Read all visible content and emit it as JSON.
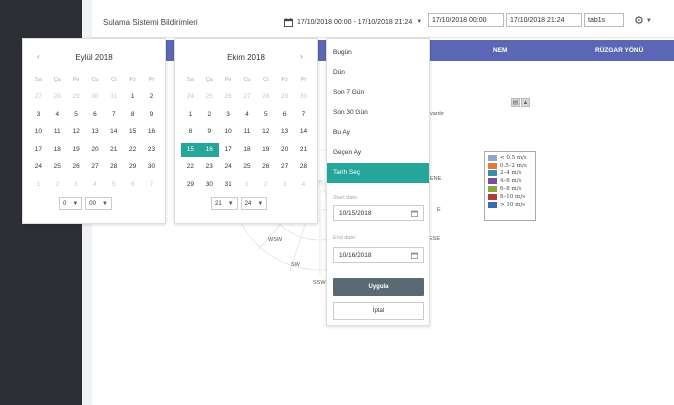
{
  "header": {
    "title": "Sulama Sistemi Bildirimleri",
    "range_label": "17/10/2018 00:00 - 17/10/2018 21:24",
    "input_start": "17/10/2018 00:00",
    "input_end": "17/10/2018 21:24",
    "input_tab": "tab1s"
  },
  "table": {
    "col_nem": "NEM",
    "col_ruzgar": "RÜZGAR YÖNÜ"
  },
  "chart": {
    "note": "vardır",
    "compass": {
      "ene": "ENE",
      "e": "E",
      "ese": "ESE",
      "wsw": "WSW",
      "sw": "SW",
      "ssw": "SSW"
    },
    "legend": [
      {
        "label": "< 0.5 m/s",
        "color": "#8fa8c8"
      },
      {
        "label": "0.5–2 m/s",
        "color": "#e07b39"
      },
      {
        "label": "2–4 m/s",
        "color": "#3a8fa6"
      },
      {
        "label": "4–6 m/s",
        "color": "#7b4ea3"
      },
      {
        "label": "6–8 m/s",
        "color": "#8aa83a"
      },
      {
        "label": "8–10 m/s",
        "color": "#b23a3a"
      },
      {
        "label": "> 10 m/s",
        "color": "#3a6ab2"
      }
    ]
  },
  "calendar1": {
    "title": "Eylül 2018",
    "days_of_week": [
      "Sa",
      "Ça",
      "Pe",
      "Cu",
      "Ct",
      "Pz",
      "Pt"
    ],
    "weeks": [
      [
        {
          "d": "27",
          "o": true
        },
        {
          "d": "28",
          "o": true
        },
        {
          "d": "29",
          "o": true
        },
        {
          "d": "30",
          "o": true
        },
        {
          "d": "31",
          "o": true
        },
        {
          "d": "1"
        },
        {
          "d": "2"
        }
      ],
      [
        {
          "d": "3"
        },
        {
          "d": "4"
        },
        {
          "d": "5"
        },
        {
          "d": "6"
        },
        {
          "d": "7"
        },
        {
          "d": "8"
        },
        {
          "d": "9"
        }
      ],
      [
        {
          "d": "10"
        },
        {
          "d": "11"
        },
        {
          "d": "12"
        },
        {
          "d": "13"
        },
        {
          "d": "14"
        },
        {
          "d": "15"
        },
        {
          "d": "16"
        }
      ],
      [
        {
          "d": "17"
        },
        {
          "d": "18"
        },
        {
          "d": "19"
        },
        {
          "d": "20"
        },
        {
          "d": "21"
        },
        {
          "d": "22"
        },
        {
          "d": "23"
        }
      ],
      [
        {
          "d": "24"
        },
        {
          "d": "25"
        },
        {
          "d": "26"
        },
        {
          "d": "27"
        },
        {
          "d": "28"
        },
        {
          "d": "29"
        },
        {
          "d": "30"
        }
      ],
      [
        {
          "d": "1",
          "o": true
        },
        {
          "d": "2",
          "o": true
        },
        {
          "d": "3",
          "o": true
        },
        {
          "d": "4",
          "o": true
        },
        {
          "d": "5",
          "o": true
        },
        {
          "d": "6",
          "o": true
        },
        {
          "d": "7",
          "o": true
        }
      ]
    ],
    "hour": "0",
    "minute": "00"
  },
  "calendar2": {
    "title": "Ekim 2018",
    "days_of_week": [
      "Sa",
      "Ça",
      "Pe",
      "Cu",
      "Ct",
      "Pz",
      "Pt"
    ],
    "weeks": [
      [
        {
          "d": "24",
          "o": true
        },
        {
          "d": "25",
          "o": true
        },
        {
          "d": "26",
          "o": true
        },
        {
          "d": "27",
          "o": true
        },
        {
          "d": "28",
          "o": true
        },
        {
          "d": "29",
          "o": true
        },
        {
          "d": "30",
          "o": true
        }
      ],
      [
        {
          "d": "1"
        },
        {
          "d": "2"
        },
        {
          "d": "3"
        },
        {
          "d": "4"
        },
        {
          "d": "5"
        },
        {
          "d": "6"
        },
        {
          "d": "7"
        }
      ],
      [
        {
          "d": "8"
        },
        {
          "d": "9"
        },
        {
          "d": "10"
        },
        {
          "d": "11"
        },
        {
          "d": "12"
        },
        {
          "d": "13"
        },
        {
          "d": "14"
        }
      ],
      [
        {
          "d": "15",
          "s": true
        },
        {
          "d": "16",
          "s": true
        },
        {
          "d": "17"
        },
        {
          "d": "18"
        },
        {
          "d": "19"
        },
        {
          "d": "20"
        },
        {
          "d": "21"
        }
      ],
      [
        {
          "d": "22"
        },
        {
          "d": "23"
        },
        {
          "d": "24"
        },
        {
          "d": "25"
        },
        {
          "d": "26"
        },
        {
          "d": "27"
        },
        {
          "d": "28"
        }
      ],
      [
        {
          "d": "29"
        },
        {
          "d": "30"
        },
        {
          "d": "31"
        },
        {
          "d": "1",
          "o": true
        },
        {
          "d": "2",
          "o": true
        },
        {
          "d": "3",
          "o": true
        },
        {
          "d": "4",
          "o": true
        }
      ]
    ],
    "hour": "21",
    "minute": "24"
  },
  "ranges": {
    "items": [
      "Bugün",
      "Dün",
      "Son 7 Gün",
      "Son 30 Gün",
      "Bu Ay",
      "Geçen Ay",
      "Tarih Seç"
    ],
    "active_index": 6,
    "start_label": "Start date:",
    "start_value": "10/15/2018",
    "end_label": "End date:",
    "end_value": "10/16/2018",
    "apply": "Uygula",
    "cancel": "İptal"
  },
  "colors": {
    "accent": "#26a69a",
    "header_bar": "#5b67b5",
    "sidebar": "#2c3034",
    "apply_btn": "#5a6a73"
  }
}
